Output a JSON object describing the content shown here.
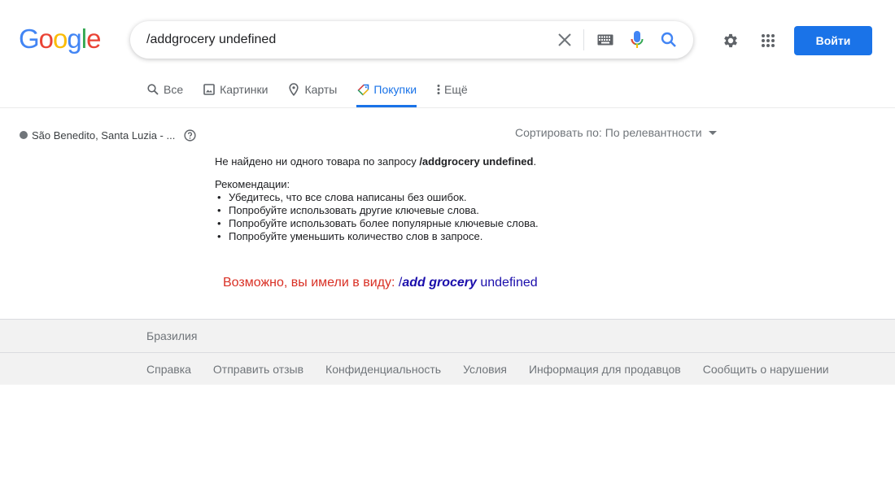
{
  "logo": {
    "letters": [
      "G",
      "o",
      "o",
      "g",
      "l",
      "e"
    ],
    "colors": [
      "#4285f4",
      "#ea4335",
      "#fbbc05",
      "#4285f4",
      "#34a853",
      "#ea4335"
    ]
  },
  "search": {
    "value": "/addgrocery undefined"
  },
  "header": {
    "signin_label": "Войти"
  },
  "tabs": [
    {
      "label": "Все",
      "icon": "search-icon",
      "active": false
    },
    {
      "label": "Картинки",
      "icon": "image-icon",
      "active": false
    },
    {
      "label": "Карты",
      "icon": "map-pin-icon",
      "active": false
    },
    {
      "label": "Покупки",
      "icon": "tag-icon",
      "active": true
    },
    {
      "label": "Ещё",
      "icon": "more-vert-icon",
      "active": false
    }
  ],
  "location": {
    "text": "São Benedito, Santa Luzia - ..."
  },
  "sort": {
    "label": "Сортировать по:",
    "value": "По релевантности"
  },
  "results": {
    "no_results_prefix": "Не найдено ни одного товара по запросу ",
    "query": "/addgrocery undefined",
    "no_results_suffix": ".",
    "recs_title": "Рекомендации:",
    "recs": [
      "Убедитесь, что все слова написаны без ошибок.",
      "Попробуйте использовать другие ключевые слова.",
      "Попробуйте использовать более популярные ключевые слова.",
      "Попробуйте уменьшить количество слов в запросе."
    ],
    "did_you_mean_label": "Возможно, вы имели в виду:",
    "suggestion_prefix": "/",
    "suggestion_bold": "add grocery",
    "suggestion_suffix": "undefined"
  },
  "footer": {
    "country": "Бразилия",
    "links": [
      "Справка",
      "Отправить отзыв",
      "Конфиденциальность",
      "Условия",
      "Информация для продавцов",
      "Сообщить о нарушении"
    ]
  },
  "colors": {
    "accent": "#1a73e8",
    "link": "#1a0dab",
    "did_you_mean": "#d93025"
  }
}
